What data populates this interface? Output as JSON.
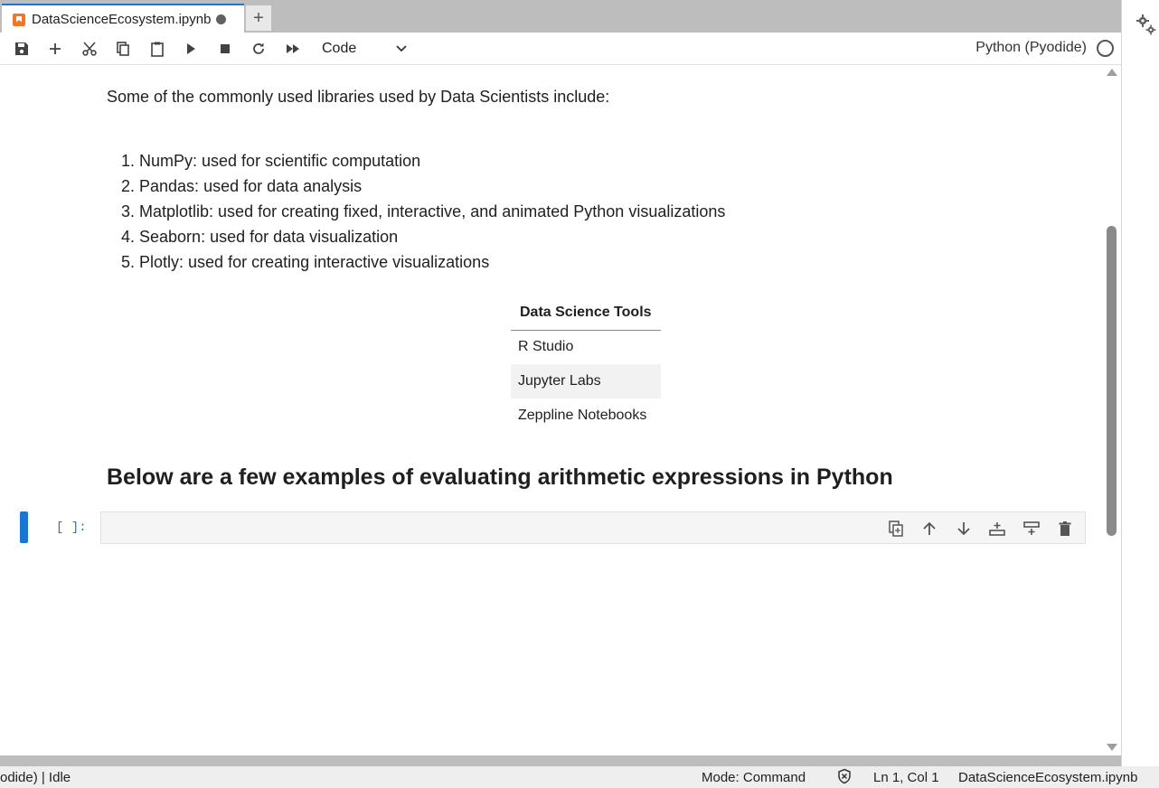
{
  "tab": {
    "title": "DataScienceEcosystem.ipynb",
    "new_tab_label": "+"
  },
  "toolbar": {
    "cell_type": "Code",
    "kernel_name": "Python (Pyodide)",
    "icons": [
      "save-icon",
      "add-icon",
      "cut-icon",
      "copy-icon",
      "paste-icon",
      "run-icon",
      "stop-icon",
      "restart-icon",
      "fast-forward-icon"
    ]
  },
  "notebook": {
    "intro": "Some of the commonly used libraries used by Data Scientists include:",
    "libraries": [
      "1. NumPy: used for scientific computation",
      "2. Pandas: used for data analysis",
      "3. Matplotlib: used for creating fixed, interactive, and animated Python visualizations",
      "4. Seaborn: used for data visualization",
      "5. Plotly: used for creating interactive visualizations"
    ],
    "table": {
      "header": "Data Science Tools",
      "rows": [
        "R Studio",
        "Jupyter Labs",
        "Zeppline Notebooks"
      ]
    },
    "heading": "Below are a few examples of evaluating arithmetic expressions in Python",
    "code_cell": {
      "prompt": "[ ]:",
      "value": ""
    }
  },
  "status": {
    "kernel": "odide) | Idle",
    "mode": "Mode: Command",
    "position": "Ln 1, Col 1",
    "file": "DataScienceEcosystem.ipynb"
  },
  "colors": {
    "accent": "#1976d2",
    "jupyter_orange": "#f37626"
  }
}
